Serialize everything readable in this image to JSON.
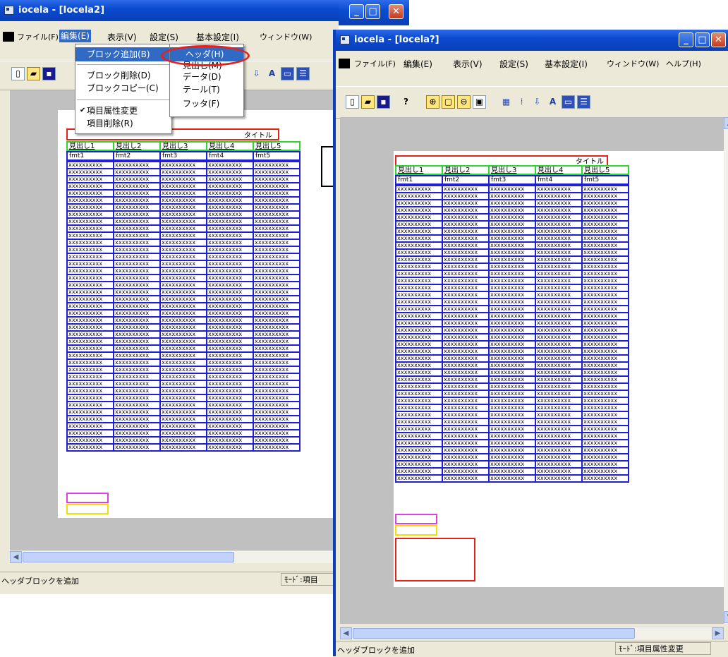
{
  "left_window": {
    "title": "iocela - [Iocela2]",
    "menu": [
      "ファイル(F)",
      "編集(E)",
      "表示(V)",
      "設定(S)",
      "基本設定(I)",
      "ウィンドウ(W)"
    ],
    "status_message": "ヘッダブロックを追加",
    "status_mode": "ﾓｰﾄﾞ:項目"
  },
  "edit_menu": {
    "items": [
      "ブロック追加(B)",
      "ブロック削除(D)",
      "ブロックコピー(C)",
      "項目属性変更",
      "項目削除(R)"
    ],
    "checked": "✔"
  },
  "submenu": {
    "items": [
      "ヘッダ(H)",
      "見出し(M)",
      "データ(D)",
      "テール(T)",
      "フッタ(F)"
    ]
  },
  "right_window": {
    "title": "iocela - [Iocela?]",
    "menu": [
      "ファイル(F)",
      "編集(E)",
      "表示(V)",
      "設定(S)",
      "基本設定(I)",
      "ウィンドウ(W)",
      "ヘルプ(H)"
    ],
    "status_message": "ヘッダブロックを追加",
    "status_mode": "ﾓｰﾄﾞ:項目属性変更"
  },
  "report": {
    "title": "タイトル",
    "headers": [
      "見出し1",
      "見出し2",
      "見出し3",
      "見出し4",
      "見出し5"
    ],
    "formats": [
      "fmt1",
      "fmt2",
      "fmt3",
      "fmt4",
      "fmt5"
    ],
    "cell_placeholder": "XXXXXXXXXX"
  },
  "icons": {
    "minimize": "_",
    "maximize": "□",
    "close": "✕",
    "scroll_left": "◀",
    "scroll_right": "▶",
    "scroll_up": "▲",
    "scroll_down": "▼"
  },
  "colors": {
    "title_border": "#e5221a",
    "header_border": "#2bd82b",
    "data_border": "#1f1fd6",
    "tail_border": "#e040e0",
    "footer_border": "#f0e000",
    "highlight": "#316ac5"
  }
}
